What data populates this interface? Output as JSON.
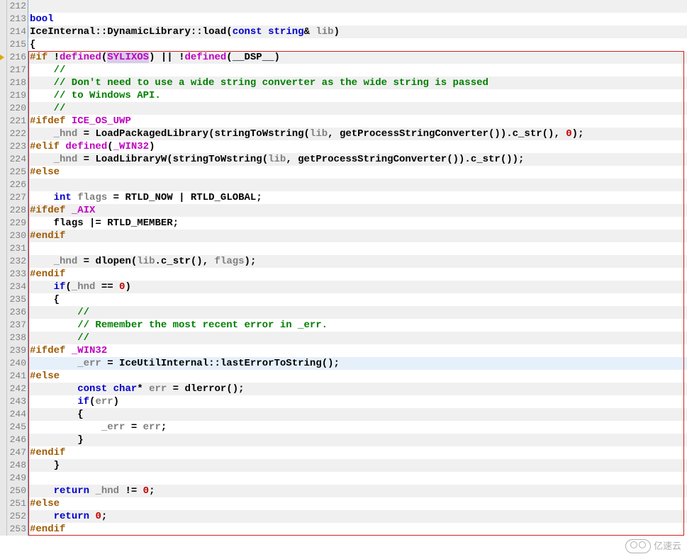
{
  "watermark": "亿速云",
  "lines": [
    {
      "n": 212,
      "alt": true,
      "tokens": []
    },
    {
      "n": 213,
      "alt": false,
      "tokens": [
        {
          "t": "bool",
          "c": "kw"
        }
      ]
    },
    {
      "n": 214,
      "alt": true,
      "tokens": [
        {
          "t": "IceInternal",
          "c": "id"
        },
        {
          "t": "::",
          "c": "op"
        },
        {
          "t": "DynamicLibrary",
          "c": "id"
        },
        {
          "t": "::",
          "c": "op"
        },
        {
          "t": "load",
          "c": "id"
        },
        {
          "t": "(",
          "c": "pun"
        },
        {
          "t": "const",
          "c": "kw"
        },
        {
          "t": " ",
          "c": "id"
        },
        {
          "t": "string",
          "c": "kw"
        },
        {
          "t": "& ",
          "c": "op"
        },
        {
          "t": "lib",
          "c": "g"
        },
        {
          "t": ")",
          "c": "pun"
        }
      ]
    },
    {
      "n": 215,
      "alt": false,
      "tokens": [
        {
          "t": "{",
          "c": "pun"
        }
      ]
    },
    {
      "n": 216,
      "alt": true,
      "arrow": true,
      "tokens": [
        {
          "t": "#if",
          "c": "pp"
        },
        {
          "t": " !",
          "c": "op"
        },
        {
          "t": "defined",
          "c": "mac"
        },
        {
          "t": "(",
          "c": "pun"
        },
        {
          "t": "SYLIXOS",
          "c": "mac hlspan"
        },
        {
          "t": ")",
          "c": "pun"
        },
        {
          "t": " || !",
          "c": "op"
        },
        {
          "t": "defined",
          "c": "mac"
        },
        {
          "t": "(",
          "c": "pun"
        },
        {
          "t": "__DSP__",
          "c": "id"
        },
        {
          "t": ")",
          "c": "pun"
        }
      ]
    },
    {
      "n": 217,
      "alt": false,
      "tokens": [
        {
          "t": "    //",
          "c": "cm"
        }
      ]
    },
    {
      "n": 218,
      "alt": true,
      "tokens": [
        {
          "t": "    // Don't need to use a wide string converter as the wide string is passed",
          "c": "cm"
        }
      ]
    },
    {
      "n": 219,
      "alt": false,
      "tokens": [
        {
          "t": "    // to Windows API.",
          "c": "cm"
        }
      ]
    },
    {
      "n": 220,
      "alt": true,
      "tokens": [
        {
          "t": "    //",
          "c": "cm"
        }
      ]
    },
    {
      "n": 221,
      "alt": false,
      "tokens": [
        {
          "t": "#ifdef",
          "c": "pp"
        },
        {
          "t": " ",
          "c": "id"
        },
        {
          "t": "ICE_OS_UWP",
          "c": "mac"
        }
      ]
    },
    {
      "n": 222,
      "alt": true,
      "tokens": [
        {
          "t": "    ",
          "c": "id"
        },
        {
          "t": "_hnd",
          "c": "g"
        },
        {
          "t": " = ",
          "c": "op"
        },
        {
          "t": "LoadPackagedLibrary",
          "c": "id"
        },
        {
          "t": "(",
          "c": "pun"
        },
        {
          "t": "stringToWstring",
          "c": "id"
        },
        {
          "t": "(",
          "c": "pun"
        },
        {
          "t": "lib",
          "c": "g"
        },
        {
          "t": ", ",
          "c": "pun"
        },
        {
          "t": "getProcessStringConverter",
          "c": "id"
        },
        {
          "t": "()",
          "c": "pun"
        },
        {
          "t": ")",
          "c": "pun"
        },
        {
          "t": ".",
          "c": "op"
        },
        {
          "t": "c_str",
          "c": "id"
        },
        {
          "t": "()",
          "c": "pun"
        },
        {
          "t": ", ",
          "c": "pun"
        },
        {
          "t": "0",
          "c": "num"
        },
        {
          "t": ");",
          "c": "pun"
        }
      ]
    },
    {
      "n": 223,
      "alt": false,
      "tokens": [
        {
          "t": "#elif",
          "c": "pp"
        },
        {
          "t": " ",
          "c": "id"
        },
        {
          "t": "defined",
          "c": "mac"
        },
        {
          "t": "(",
          "c": "pun"
        },
        {
          "t": "_WIN32",
          "c": "mac"
        },
        {
          "t": ")",
          "c": "pun"
        }
      ]
    },
    {
      "n": 224,
      "alt": true,
      "tokens": [
        {
          "t": "    ",
          "c": "id"
        },
        {
          "t": "_hnd",
          "c": "g"
        },
        {
          "t": " = ",
          "c": "op"
        },
        {
          "t": "LoadLibraryW",
          "c": "id"
        },
        {
          "t": "(",
          "c": "pun"
        },
        {
          "t": "stringToWstring",
          "c": "id"
        },
        {
          "t": "(",
          "c": "pun"
        },
        {
          "t": "lib",
          "c": "g"
        },
        {
          "t": ", ",
          "c": "pun"
        },
        {
          "t": "getProcessStringConverter",
          "c": "id"
        },
        {
          "t": "()",
          "c": "pun"
        },
        {
          "t": ")",
          "c": "pun"
        },
        {
          "t": ".",
          "c": "op"
        },
        {
          "t": "c_str",
          "c": "id"
        },
        {
          "t": "()",
          "c": "pun"
        },
        {
          "t": ");",
          "c": "pun"
        }
      ]
    },
    {
      "n": 225,
      "alt": false,
      "tokens": [
        {
          "t": "#else",
          "c": "pp"
        }
      ]
    },
    {
      "n": 226,
      "alt": true,
      "tokens": []
    },
    {
      "n": 227,
      "alt": false,
      "tokens": [
        {
          "t": "    ",
          "c": "id"
        },
        {
          "t": "int",
          "c": "kw"
        },
        {
          "t": " ",
          "c": "id"
        },
        {
          "t": "flags",
          "c": "g"
        },
        {
          "t": " = ",
          "c": "op"
        },
        {
          "t": "RTLD_NOW",
          "c": "id"
        },
        {
          "t": " | ",
          "c": "op"
        },
        {
          "t": "RTLD_GLOBAL",
          "c": "id"
        },
        {
          "t": ";",
          "c": "pun"
        }
      ]
    },
    {
      "n": 228,
      "alt": true,
      "tokens": [
        {
          "t": "#ifdef",
          "c": "pp"
        },
        {
          "t": " ",
          "c": "id"
        },
        {
          "t": "_AIX",
          "c": "mac"
        }
      ]
    },
    {
      "n": 229,
      "alt": false,
      "tokens": [
        {
          "t": "    ",
          "c": "id"
        },
        {
          "t": "flags",
          "c": "id"
        },
        {
          "t": " |= ",
          "c": "op"
        },
        {
          "t": "RTLD_MEMBER",
          "c": "id"
        },
        {
          "t": ";",
          "c": "pun"
        }
      ]
    },
    {
      "n": 230,
      "alt": true,
      "tokens": [
        {
          "t": "#endif",
          "c": "pp"
        }
      ]
    },
    {
      "n": 231,
      "alt": false,
      "tokens": []
    },
    {
      "n": 232,
      "alt": true,
      "tokens": [
        {
          "t": "    ",
          "c": "id"
        },
        {
          "t": "_hnd",
          "c": "g"
        },
        {
          "t": " = ",
          "c": "op"
        },
        {
          "t": "dlopen",
          "c": "id"
        },
        {
          "t": "(",
          "c": "pun"
        },
        {
          "t": "lib",
          "c": "g"
        },
        {
          "t": ".",
          "c": "op"
        },
        {
          "t": "c_str",
          "c": "id"
        },
        {
          "t": "()",
          "c": "pun"
        },
        {
          "t": ", ",
          "c": "pun"
        },
        {
          "t": "flags",
          "c": "g"
        },
        {
          "t": ");",
          "c": "pun"
        }
      ]
    },
    {
      "n": 233,
      "alt": false,
      "tokens": [
        {
          "t": "#endif",
          "c": "pp"
        }
      ]
    },
    {
      "n": 234,
      "alt": true,
      "tokens": [
        {
          "t": "    ",
          "c": "id"
        },
        {
          "t": "if",
          "c": "kw"
        },
        {
          "t": "(",
          "c": "pun"
        },
        {
          "t": "_hnd",
          "c": "g"
        },
        {
          "t": " == ",
          "c": "op"
        },
        {
          "t": "0",
          "c": "num"
        },
        {
          "t": ")",
          "c": "pun"
        }
      ]
    },
    {
      "n": 235,
      "alt": false,
      "tokens": [
        {
          "t": "    {",
          "c": "pun"
        }
      ]
    },
    {
      "n": 236,
      "alt": true,
      "tokens": [
        {
          "t": "        //",
          "c": "cm"
        }
      ]
    },
    {
      "n": 237,
      "alt": false,
      "tokens": [
        {
          "t": "        // Remember the most recent error in _err.",
          "c": "cm"
        }
      ]
    },
    {
      "n": 238,
      "alt": true,
      "tokens": [
        {
          "t": "        //",
          "c": "cm"
        }
      ]
    },
    {
      "n": 239,
      "alt": false,
      "tokens": [
        {
          "t": "#ifdef",
          "c": "pp"
        },
        {
          "t": " ",
          "c": "id"
        },
        {
          "t": "_WIN32",
          "c": "mac"
        }
      ]
    },
    {
      "n": 240,
      "alt": true,
      "hl": true,
      "tokens": [
        {
          "t": "        ",
          "c": "id"
        },
        {
          "t": "_err",
          "c": "g"
        },
        {
          "t": " = ",
          "c": "op"
        },
        {
          "t": "IceUtilInternal",
          "c": "id"
        },
        {
          "t": "::",
          "c": "op"
        },
        {
          "t": "lastErrorToString",
          "c": "id"
        },
        {
          "t": "();",
          "c": "pun"
        }
      ]
    },
    {
      "n": 241,
      "alt": false,
      "tokens": [
        {
          "t": "#else",
          "c": "pp"
        }
      ]
    },
    {
      "n": 242,
      "alt": true,
      "tokens": [
        {
          "t": "        ",
          "c": "id"
        },
        {
          "t": "const",
          "c": "kw"
        },
        {
          "t": " ",
          "c": "id"
        },
        {
          "t": "char",
          "c": "kw"
        },
        {
          "t": "* ",
          "c": "op"
        },
        {
          "t": "err",
          "c": "g"
        },
        {
          "t": " = ",
          "c": "op"
        },
        {
          "t": "dlerror",
          "c": "id"
        },
        {
          "t": "();",
          "c": "pun"
        }
      ]
    },
    {
      "n": 243,
      "alt": false,
      "tokens": [
        {
          "t": "        ",
          "c": "id"
        },
        {
          "t": "if",
          "c": "kw"
        },
        {
          "t": "(",
          "c": "pun"
        },
        {
          "t": "err",
          "c": "g"
        },
        {
          "t": ")",
          "c": "pun"
        }
      ]
    },
    {
      "n": 244,
      "alt": true,
      "tokens": [
        {
          "t": "        {",
          "c": "pun"
        }
      ]
    },
    {
      "n": 245,
      "alt": false,
      "tokens": [
        {
          "t": "            ",
          "c": "id"
        },
        {
          "t": "_err",
          "c": "g"
        },
        {
          "t": " = ",
          "c": "op"
        },
        {
          "t": "err",
          "c": "g"
        },
        {
          "t": ";",
          "c": "pun"
        }
      ]
    },
    {
      "n": 246,
      "alt": true,
      "tokens": [
        {
          "t": "        }",
          "c": "pun"
        }
      ]
    },
    {
      "n": 247,
      "alt": false,
      "tokens": [
        {
          "t": "#endif",
          "c": "pp"
        }
      ]
    },
    {
      "n": 248,
      "alt": true,
      "tokens": [
        {
          "t": "    }",
          "c": "pun"
        }
      ]
    },
    {
      "n": 249,
      "alt": false,
      "tokens": []
    },
    {
      "n": 250,
      "alt": true,
      "tokens": [
        {
          "t": "    ",
          "c": "id"
        },
        {
          "t": "return",
          "c": "kw"
        },
        {
          "t": " ",
          "c": "id"
        },
        {
          "t": "_hnd",
          "c": "g"
        },
        {
          "t": " != ",
          "c": "op"
        },
        {
          "t": "0",
          "c": "num"
        },
        {
          "t": ";",
          "c": "pun"
        }
      ]
    },
    {
      "n": 251,
      "alt": false,
      "tokens": [
        {
          "t": "#else",
          "c": "pp"
        }
      ]
    },
    {
      "n": 252,
      "alt": true,
      "tokens": [
        {
          "t": "    ",
          "c": "id"
        },
        {
          "t": "return",
          "c": "kw"
        },
        {
          "t": " ",
          "c": "id"
        },
        {
          "t": "0",
          "c": "num"
        },
        {
          "t": ";",
          "c": "pun"
        }
      ]
    },
    {
      "n": 253,
      "alt": false,
      "tokens": [
        {
          "t": "#endif",
          "c": "pp"
        }
      ]
    }
  ]
}
